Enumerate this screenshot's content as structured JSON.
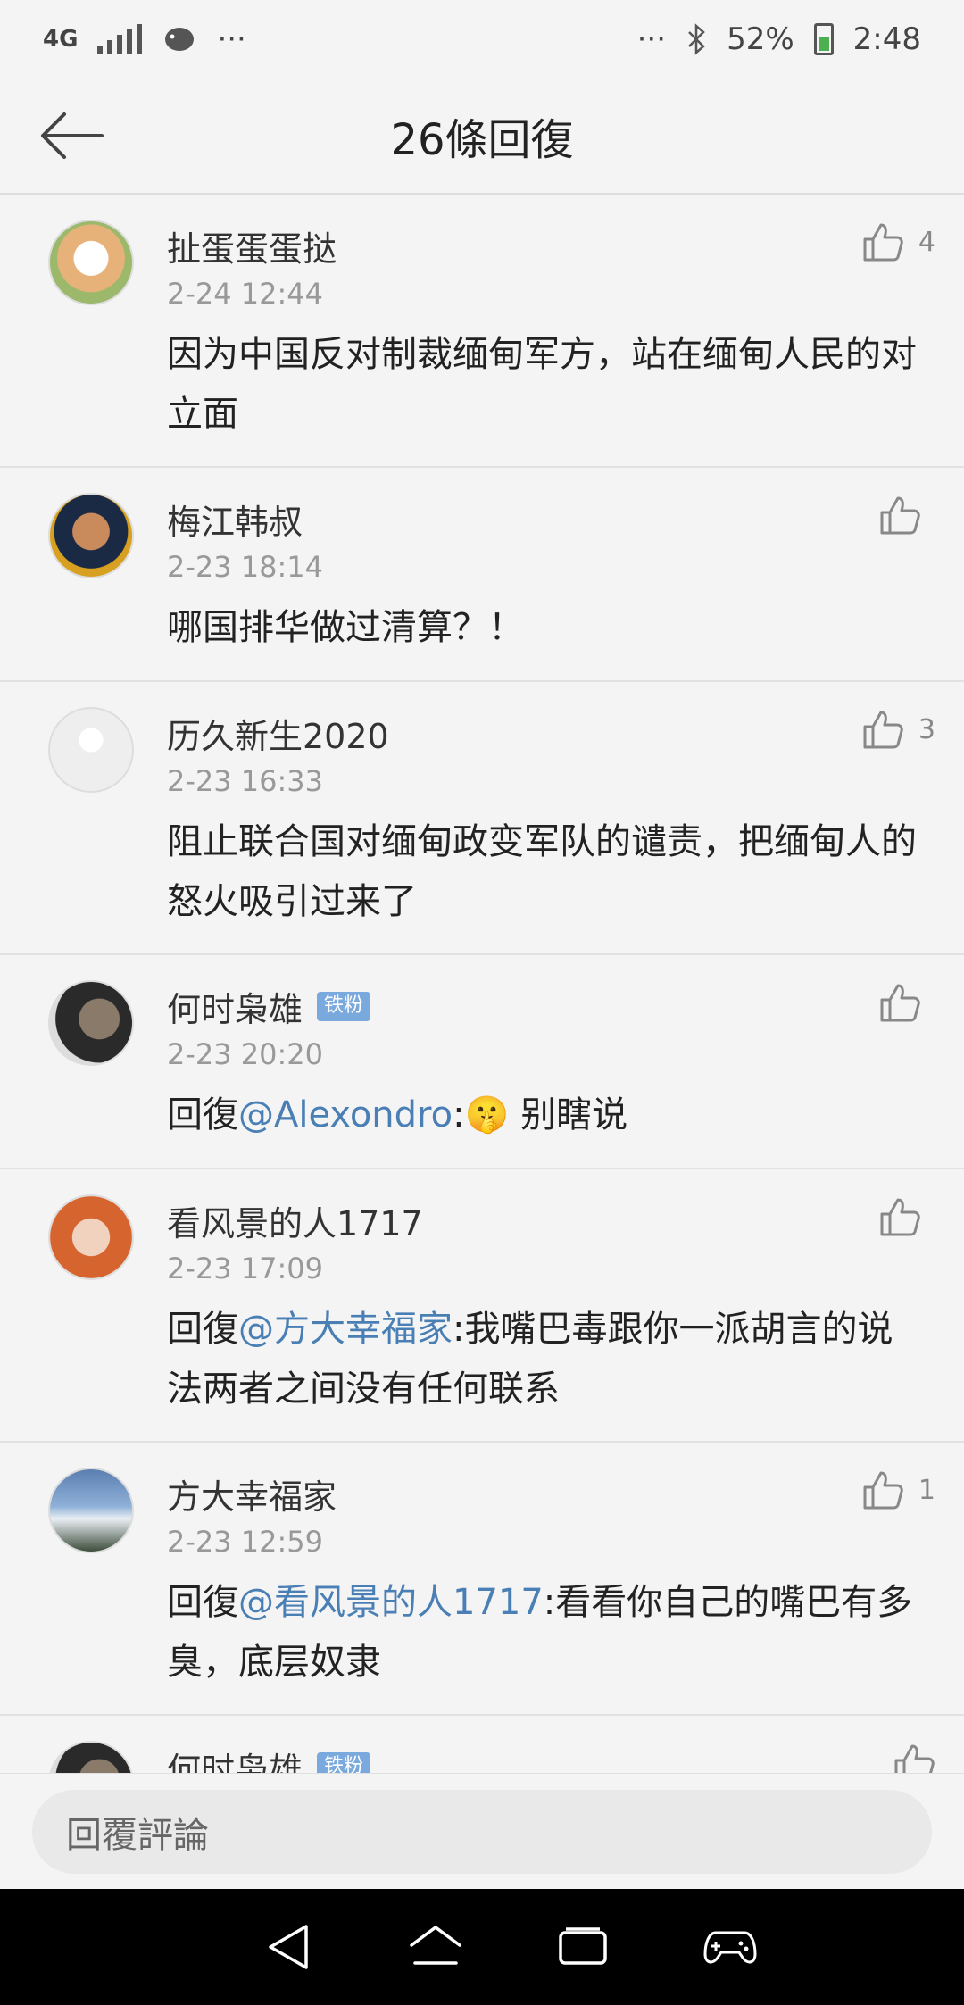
{
  "status_bar": {
    "network": "4G",
    "more": "···",
    "more_right": "···",
    "battery": "52%",
    "time": "2:48"
  },
  "header": {
    "title": "26條回復"
  },
  "comments": [
    {
      "user": "扯蛋蛋蛋挞",
      "badge": "",
      "time": "2-24 12:44",
      "likes": "4",
      "parts": [
        {
          "text": "因为中国反对制裁缅甸军方，站在缅甸人民的对立面",
          "mention": false
        }
      ]
    },
    {
      "user": "梅江韩叔",
      "badge": "",
      "time": "2-23 18:14",
      "likes": "",
      "parts": [
        {
          "text": "哪国排华做过清算？！",
          "mention": false
        }
      ]
    },
    {
      "user": "历久新生2020",
      "badge": "",
      "time": "2-23 16:33",
      "likes": "3",
      "parts": [
        {
          "text": "阻止联合国对缅甸政变军队的谴责，把缅甸人的怒火吸引过来了",
          "mention": false
        }
      ]
    },
    {
      "user": "何时枭雄",
      "badge": "铁粉",
      "time": "2-23 20:20",
      "likes": "",
      "parts": [
        {
          "text": "回復",
          "mention": false
        },
        {
          "text": "@Alexondro",
          "mention": true
        },
        {
          "text": ":🤫 别瞎说",
          "mention": false
        }
      ]
    },
    {
      "user": "看风景的人1717",
      "badge": "",
      "time": "2-23 17:09",
      "likes": "",
      "parts": [
        {
          "text": "回復",
          "mention": false
        },
        {
          "text": "@方大幸福家",
          "mention": true
        },
        {
          "text": ":我嘴巴毒跟你一派胡言的说法两者之间没有任何联系",
          "mention": false
        }
      ]
    },
    {
      "user": "方大幸福家",
      "badge": "",
      "time": "2-23 12:59",
      "likes": "1",
      "parts": [
        {
          "text": "回復",
          "mention": false
        },
        {
          "text": "@看风景的人1717",
          "mention": true
        },
        {
          "text": ":看看你自己的嘴巴有多臭，底层奴隶",
          "mention": false
        }
      ]
    },
    {
      "user": "何时枭雄",
      "badge": "铁粉",
      "time": "",
      "likes": "",
      "parts": []
    }
  ],
  "reply_bar": {
    "placeholder": "回覆評論"
  },
  "colors": {
    "mention": "#4a7fb5",
    "badge": "#7aa9de"
  },
  "icons": [
    "back-arrow-icon",
    "thumbs-up-icon",
    "nav-back-icon",
    "nav-home-icon",
    "nav-recents-icon",
    "gamepad-icon"
  ]
}
